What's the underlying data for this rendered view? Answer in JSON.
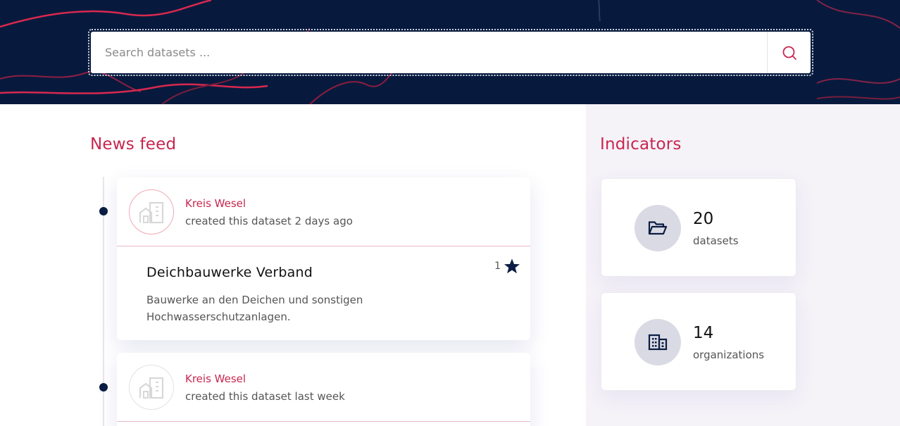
{
  "search": {
    "placeholder": "Search datasets ..."
  },
  "news_feed": {
    "title": "News feed",
    "items": [
      {
        "organization": "Kreis Wesel",
        "activity": "created this dataset 2 days ago",
        "dataset_title": "Deichbauwerke Verband",
        "dataset_description": "Bauwerke an den Deichen und sonstigen Hochwasserschutzanlagen.",
        "stars": "1"
      },
      {
        "organization": "Kreis Wesel",
        "activity": "created this dataset last week"
      }
    ]
  },
  "indicators": {
    "title": "Indicators",
    "items": [
      {
        "value": "20",
        "label": "datasets",
        "icon": "folder-open-icon"
      },
      {
        "value": "14",
        "label": "organizations",
        "icon": "building-icon"
      }
    ]
  },
  "colors": {
    "header_bg": "#071a3d",
    "accent": "#c8264f",
    "sidebar_bg": "#f5f2f8"
  }
}
